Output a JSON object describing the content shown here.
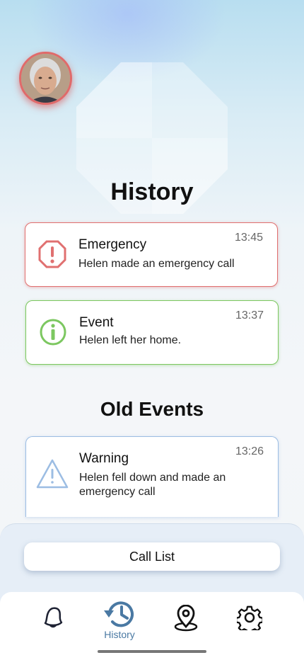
{
  "header": {
    "history_title": "History",
    "old_events_title": "Old Events"
  },
  "recent_events": [
    {
      "type": "emergency",
      "title": "Emergency",
      "description": "Helen made an emergency call",
      "time": "13:45",
      "icon": "octagon-exclamation-icon",
      "color": "#e07070"
    },
    {
      "type": "event",
      "title": "Event",
      "description": "Helen left her home.",
      "time": "13:37",
      "icon": "info-circle-icon",
      "color": "#7cc760"
    }
  ],
  "old_events": [
    {
      "type": "warning",
      "title": "Warning",
      "description": "Helen fell down and made an emergency call",
      "time": "13:26",
      "icon": "warning-triangle-icon",
      "color": "#9cbde3"
    }
  ],
  "call_list": {
    "label": "Call List"
  },
  "nav": {
    "items": [
      {
        "name": "bell",
        "icon": "bell-icon",
        "label": ""
      },
      {
        "name": "history",
        "icon": "history-icon",
        "label": "History",
        "active": true
      },
      {
        "name": "location",
        "icon": "location-pin-icon",
        "label": ""
      },
      {
        "name": "settings",
        "icon": "gear-icon",
        "label": ""
      }
    ],
    "active_color": "#4a79a3"
  }
}
